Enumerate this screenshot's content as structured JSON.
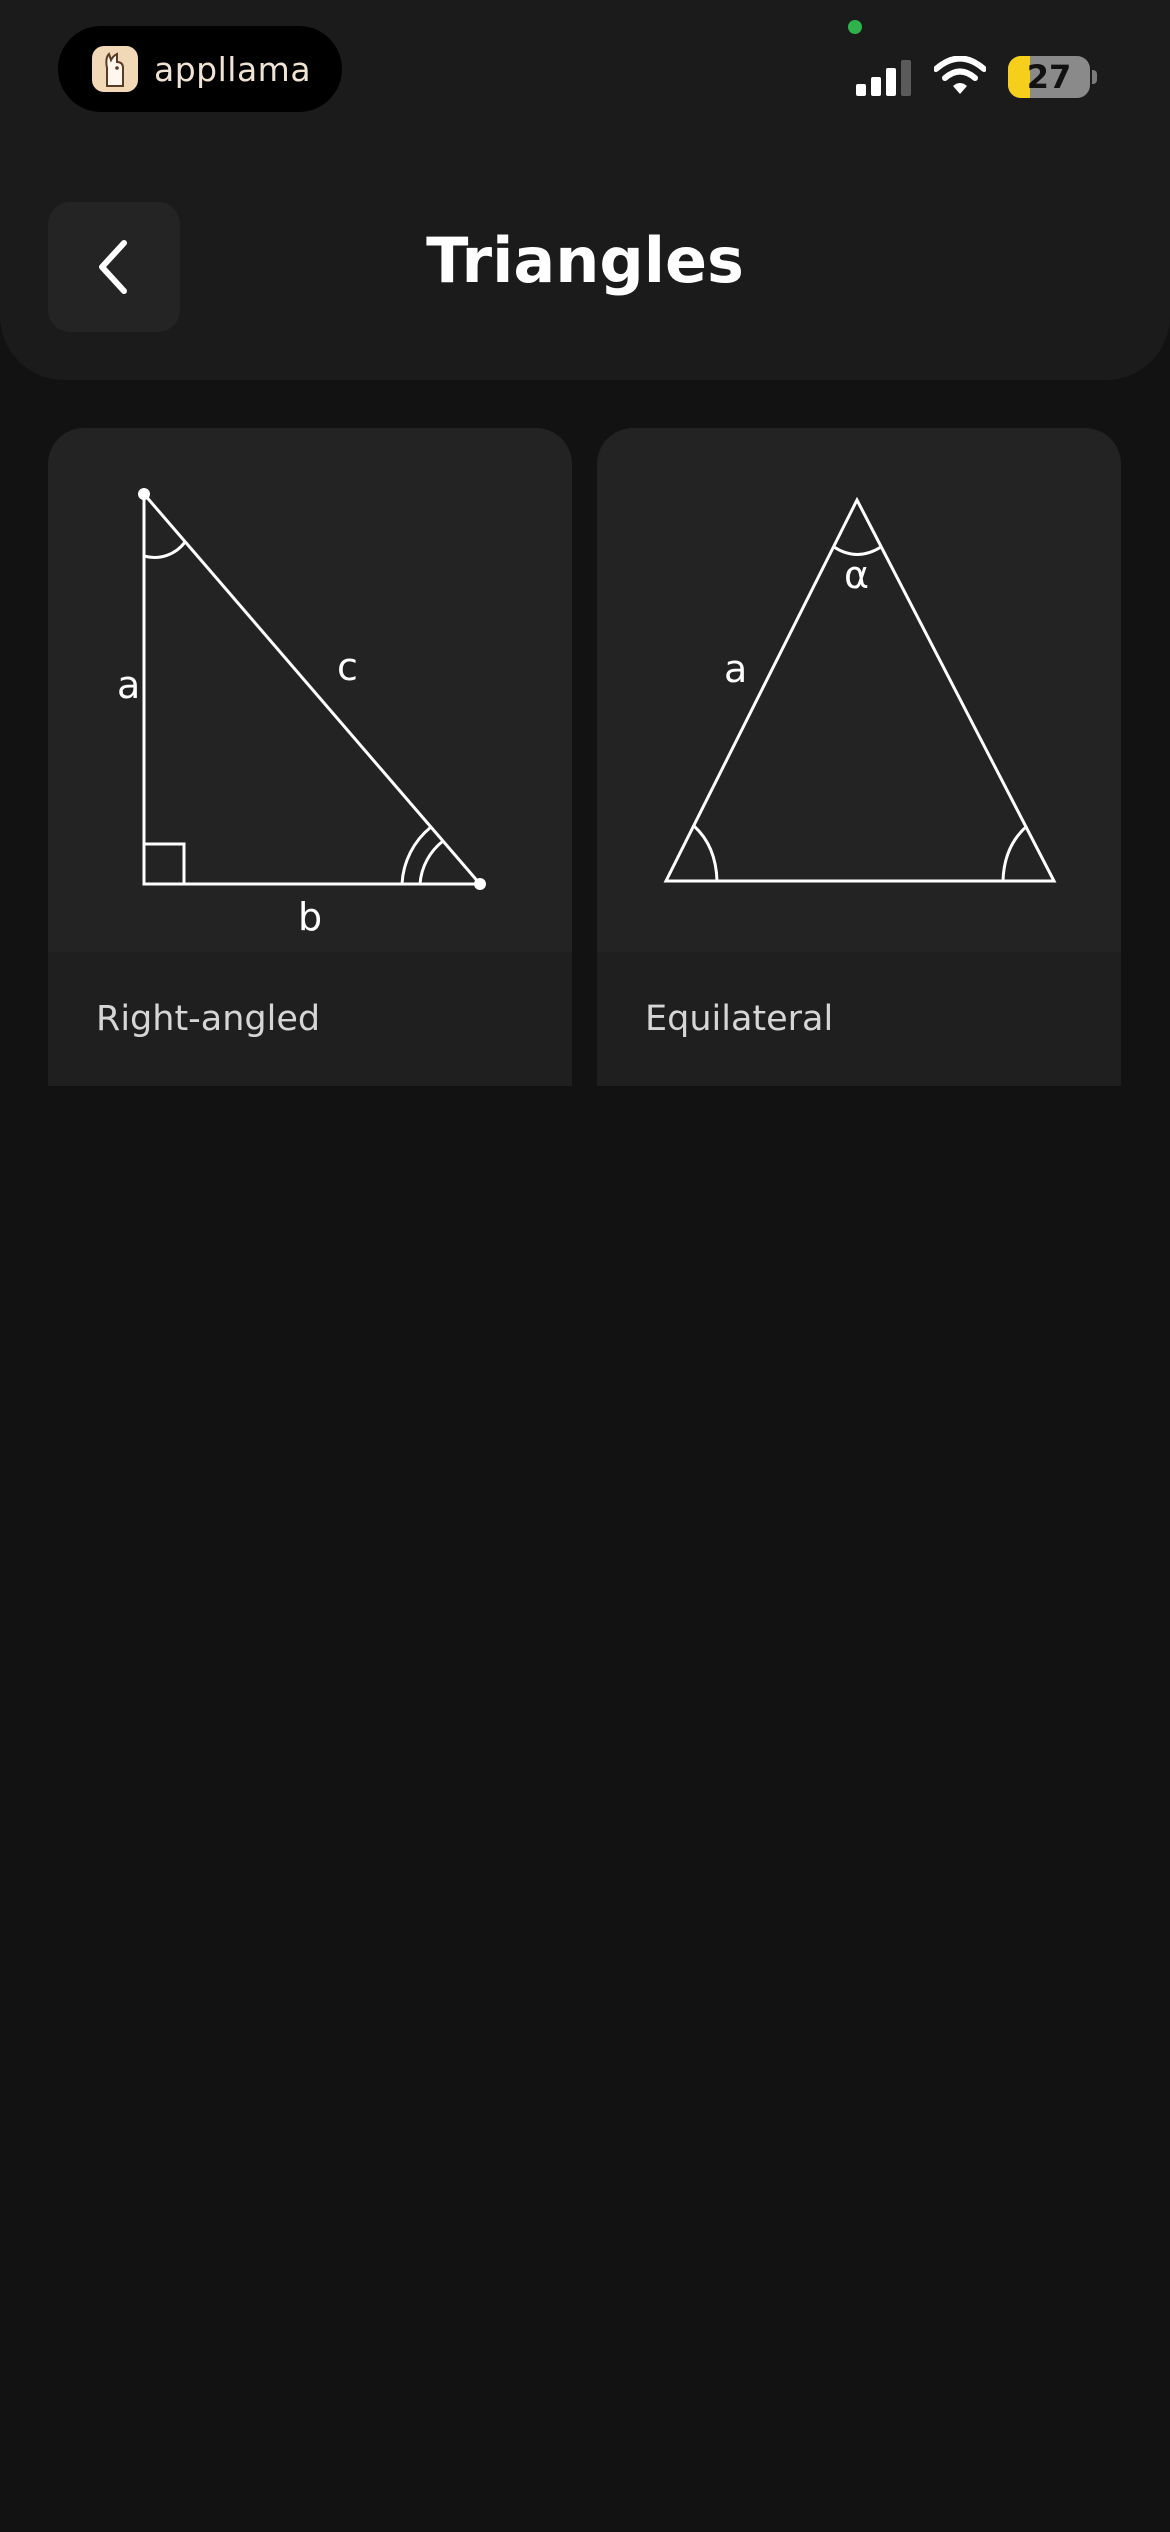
{
  "status_bar": {
    "app_name": "appllama",
    "battery_level": "27",
    "icons": [
      "llama-logo-icon",
      "cellular-signal-icon",
      "wifi-icon",
      "battery-icon"
    ]
  },
  "nav": {
    "back_icon": "chevron-left-icon",
    "title": "Triangles"
  },
  "cards": [
    {
      "label": "Right-angled",
      "diagram_labels": {
        "side_a": "a",
        "side_b": "b",
        "side_c": "c"
      }
    },
    {
      "label": "Equilateral",
      "diagram_labels": {
        "side_a": "a",
        "angle": "α"
      }
    }
  ],
  "colors": {
    "background": "#121212",
    "header": "#1b1b1b",
    "card": "#232323",
    "card_footer": "#1f1f1f",
    "battery_fill": "#f5cf1b",
    "status_dot": "#2fb24c"
  }
}
